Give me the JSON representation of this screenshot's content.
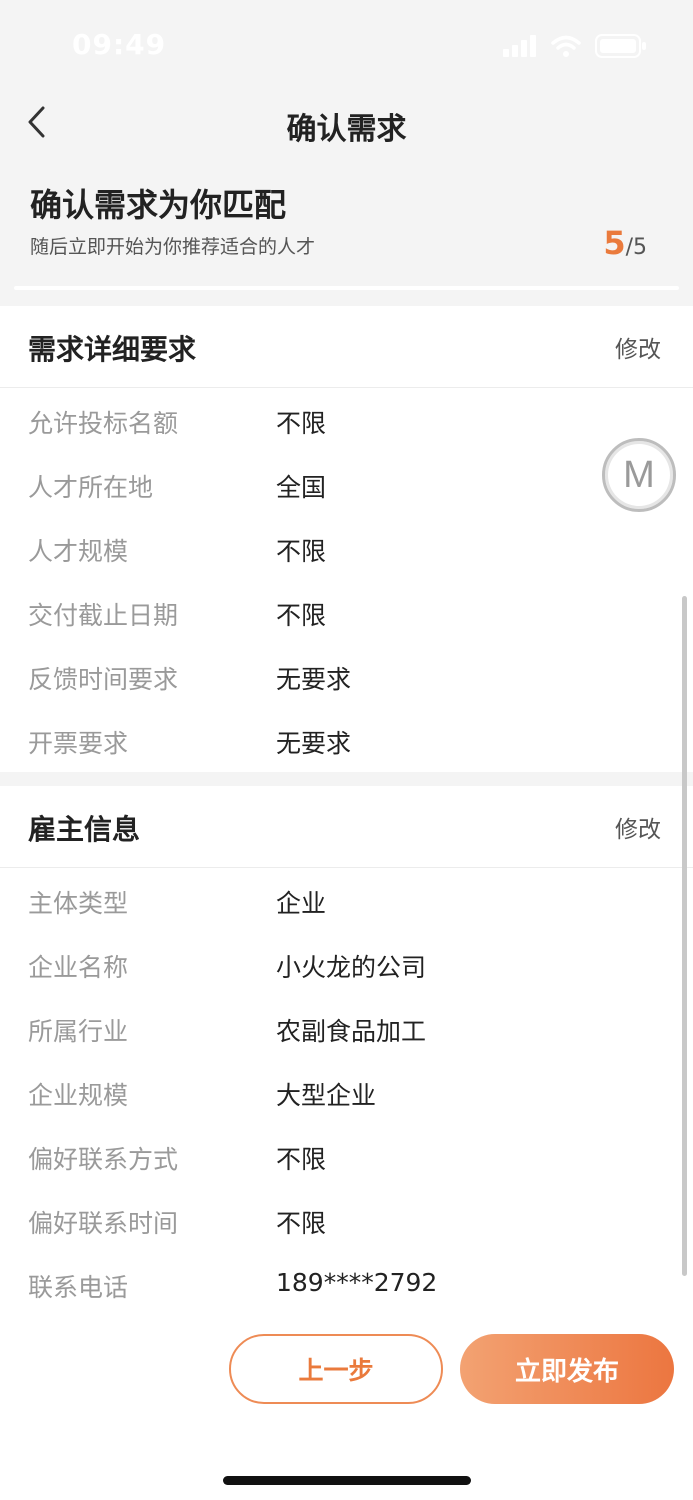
{
  "status_bar": {
    "time": "09:49"
  },
  "nav": {
    "title": "确认需求"
  },
  "header": {
    "title": "确认需求为你匹配",
    "subtitle": "随后立即开始为你推荐适合的人才",
    "step_current": "5",
    "step_total": "/5"
  },
  "requirements": {
    "title": "需求详细要求",
    "edit_label": "修改",
    "rows": [
      {
        "label": "允许投标名额",
        "value": "不限"
      },
      {
        "label": "人才所在地",
        "value": "全国"
      },
      {
        "label": "人才规模",
        "value": "不限"
      },
      {
        "label": "交付截止日期",
        "value": "不限"
      },
      {
        "label": "反馈时间要求",
        "value": "无要求"
      },
      {
        "label": "开票要求",
        "value": "无要求"
      }
    ]
  },
  "employer": {
    "title": "雇主信息",
    "edit_label": "修改",
    "rows": [
      {
        "label": "主体类型",
        "value": "企业"
      },
      {
        "label": "企业名称",
        "value": "小火龙的公司"
      },
      {
        "label": "所属行业",
        "value": "农副食品加工"
      },
      {
        "label": "企业规模",
        "value": "大型企业"
      },
      {
        "label": "偏好联系方式",
        "value": "不限"
      },
      {
        "label": "偏好联系时间",
        "value": "不限"
      },
      {
        "label": "联系电话",
        "value": "189****2792"
      }
    ]
  },
  "floating_button": {
    "letter": "M"
  },
  "footer": {
    "prev_label": "上一步",
    "publish_label": "立即发布"
  },
  "colors": {
    "accent": "#ea7a3c",
    "gradient_start": "#f3a272",
    "gradient_end": "#ec7640"
  }
}
